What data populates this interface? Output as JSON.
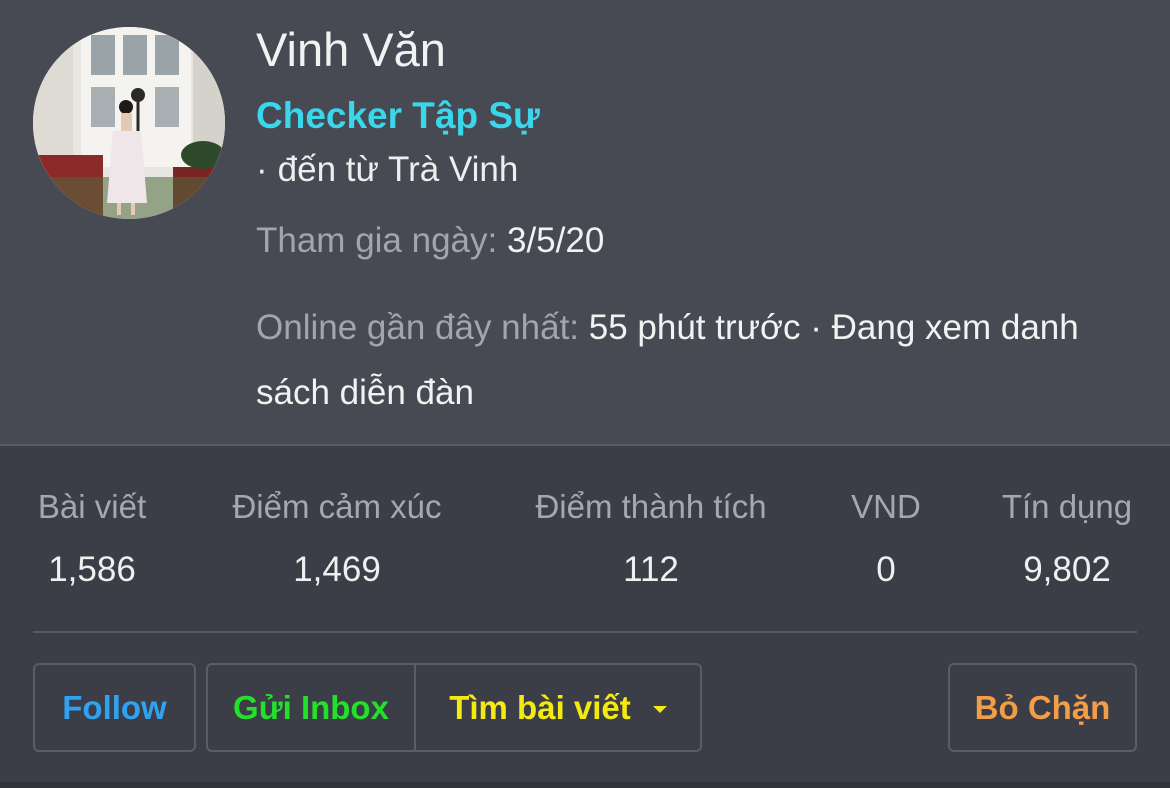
{
  "profile": {
    "name": "Vinh Văn",
    "rank": "Checker Tập Sự",
    "location_prefix": "·",
    "location_text": "đến từ Trà Vinh",
    "joined_label": "Tham gia ngày:",
    "joined_value": "3/5/20",
    "online_label": "Online gần đây nhất:",
    "online_value": "55 phút trước · Đang xem danh sách diễn đàn"
  },
  "stats": [
    {
      "label": "Bài viết",
      "value": "1,586"
    },
    {
      "label": "Điểm cảm xúc",
      "value": "1,469"
    },
    {
      "label": "Điểm thành tích",
      "value": "112"
    },
    {
      "label": "VND",
      "value": "0"
    },
    {
      "label": "Tín dụng",
      "value": "9,802"
    }
  ],
  "actions": {
    "follow": "Follow",
    "inbox": "Gửi Inbox",
    "find_posts": "Tìm bài viết",
    "unblock": "Bỏ Chặn"
  },
  "colors": {
    "rank": "#3ad7ec",
    "follow": "#2fa3f2",
    "inbox": "#23e02a",
    "find_posts": "#f2ea12",
    "unblock": "#f29d48"
  },
  "icons": {
    "dropdown": "caret-down-icon"
  }
}
